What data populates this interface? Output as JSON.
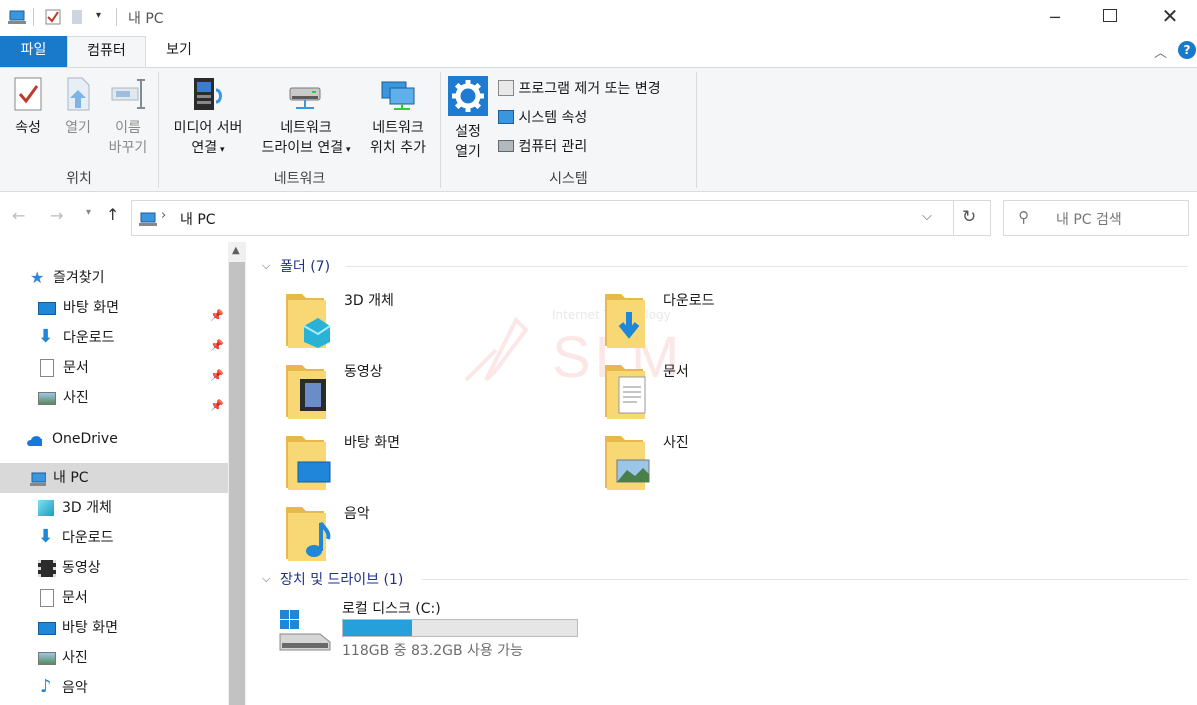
{
  "window": {
    "title": "내 PC"
  },
  "ribbon_tabs": [
    {
      "label": "파일"
    },
    {
      "label": "컴퓨터"
    },
    {
      "label": "보기"
    }
  ],
  "ribbon": {
    "location": {
      "group_label": "위치",
      "properties": "속성",
      "open": "열기",
      "rename_1": "이름",
      "rename_2": "바꾸기"
    },
    "network": {
      "group_label": "네트워크",
      "media_1": "미디어 서버",
      "media_2": "연결",
      "drive_1": "네트워크",
      "drive_2": "드라이브 연결",
      "loc_1": "네트워크",
      "loc_2": "위치 추가"
    },
    "system": {
      "group_label": "시스템",
      "settings_1": "설정",
      "settings_2": "열기",
      "uninstall": "프로그램 제거 또는 변경",
      "sysprops": "시스템 속성",
      "manage": "컴퓨터 관리"
    }
  },
  "address": {
    "path": "내 PC",
    "search_placeholder": "내 PC 검색"
  },
  "sidebar": {
    "quick_access": "즐겨찾기",
    "quick_items": [
      "바탕 화면",
      "다운로드",
      "문서",
      "사진"
    ],
    "onedrive": "OneDrive",
    "this_pc": "내 PC",
    "pc_items": [
      "3D 개체",
      "다운로드",
      "동영상",
      "문서",
      "바탕 화면",
      "사진",
      "음악"
    ]
  },
  "content": {
    "folders_header": "폴더 (7)",
    "folders": [
      "3D 개체",
      "다운로드",
      "동영상",
      "문서",
      "바탕 화면",
      "사진",
      "음악"
    ],
    "devices_header": "장치 및 드라이브 (1)",
    "drive": {
      "name": "로컬 디스크 (C:)",
      "free_text": "118GB 중 83.2GB 사용 가능",
      "used_fraction": 0.295
    }
  },
  "watermark": {
    "text": "SLM",
    "sub": "Internet Technology"
  },
  "colors": {
    "file_tab": "#1979ca",
    "drive_bar": "#26a0da",
    "accent_text": "#1e3287",
    "folder_yellow": "#f8d775"
  }
}
